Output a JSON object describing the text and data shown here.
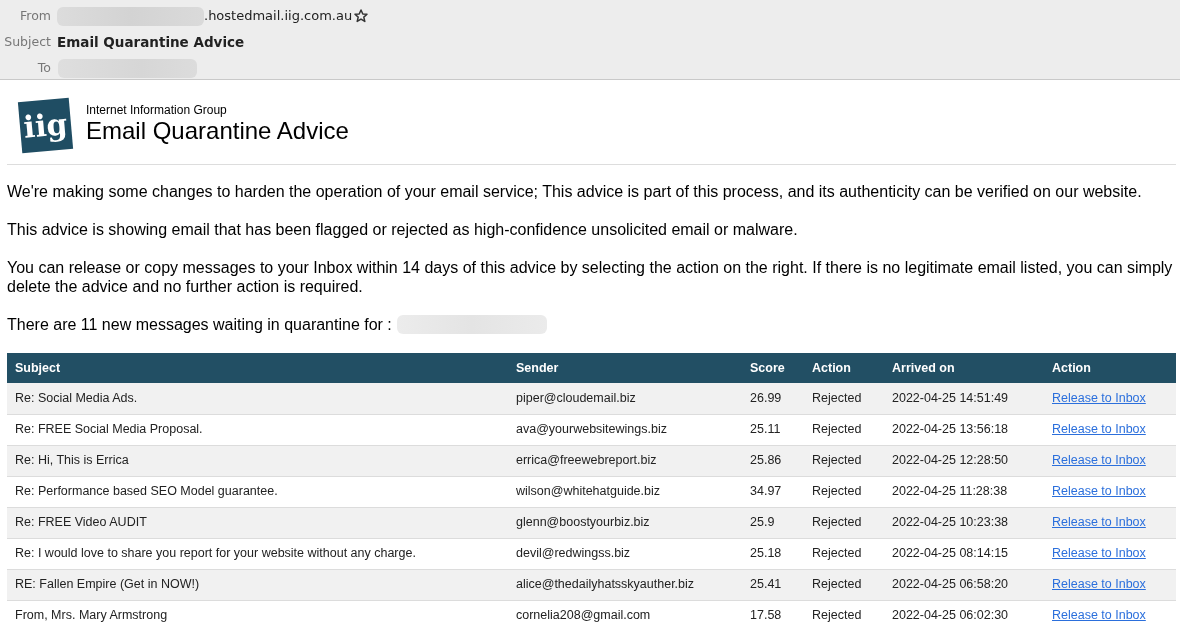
{
  "message_header": {
    "from": {
      "label": "From",
      "value": ".hostedmail.iig.com.au",
      "redacted": true,
      "starred": false
    },
    "subject": {
      "label": "Subject",
      "value": "Email Quarantine Advice"
    },
    "to": {
      "label": "To",
      "redacted": true
    }
  },
  "banner": {
    "logo": "iig",
    "organization": "Internet Information Group",
    "title": "Email Quarantine Advice"
  },
  "paragraphs": [
    {
      "text": "We're making some changes to harden the operation of your email service; This advice is part of this process, and its authenticity can be verified on our website."
    },
    {
      "text": "This advice is showing email that has been flagged or rejected as high-confidence unsolicited email or malware."
    },
    {
      "text": "You can release or copy messages to your Inbox within 14 days of this advice by selecting the action on the right. If there is no legitimate email listed, you can simply delete the advice and no further action is required."
    },
    {
      "text": "There are 11 new messages waiting in quarantine for :",
      "redacted": true
    }
  ],
  "table": {
    "columns": [
      "Subject",
      "Sender",
      "Score",
      "Action",
      "Arrived on",
      "Action"
    ],
    "rows": [
      {
        "subject": "Re: Social Media Ads.",
        "sender": "piper@cloudemail.biz",
        "score": "26.99",
        "action": "Rejected",
        "arrived_on": "2022-04-25 14:51:49",
        "link": "Release to Inbox"
      },
      {
        "subject": "Re: FREE Social Media Proposal.",
        "sender": "ava@yourwebsitewings.biz",
        "score": "25.11",
        "action": "Rejected",
        "arrived_on": "2022-04-25 13:56:18",
        "link": "Release to Inbox"
      },
      {
        "subject": "Re: Hi, This is Errica",
        "sender": "errica@freewebreport.biz",
        "score": "25.86",
        "action": "Rejected",
        "arrived_on": "2022-04-25 12:28:50",
        "link": "Release to Inbox"
      },
      {
        "subject": "Re: Performance based SEO Model guarantee.",
        "sender": "wilson@whitehatguide.biz",
        "score": "34.97",
        "action": "Rejected",
        "arrived_on": "2022-04-25 11:28:38",
        "link": "Release to Inbox"
      },
      {
        "subject": "Re: FREE Video AUDIT",
        "sender": "glenn@boostyourbiz.biz",
        "score": "25.9",
        "action": "Rejected",
        "arrived_on": "2022-04-25 10:23:38",
        "link": "Release to Inbox"
      },
      {
        "subject": "Re: I would love to share you report for your website without any charge.",
        "sender": "devil@redwingss.biz",
        "score": "25.18",
        "action": "Rejected",
        "arrived_on": "2022-04-25 08:14:15",
        "link": "Release to Inbox"
      },
      {
        "subject": "RE: Fallen Empire (Get in NOW!)",
        "sender": "alice@thedailyhatsskyauther.biz",
        "score": "25.41",
        "action": "Rejected",
        "arrived_on": "2022-04-25 06:58:20",
        "link": "Release to Inbox"
      },
      {
        "subject": "From, Mrs. Mary Armstrong",
        "sender": "cornelia208@gmail.com",
        "score": "17.58",
        "action": "Rejected",
        "arrived_on": "2022-04-25 06:02:30",
        "link": "Release to Inbox"
      }
    ]
  }
}
